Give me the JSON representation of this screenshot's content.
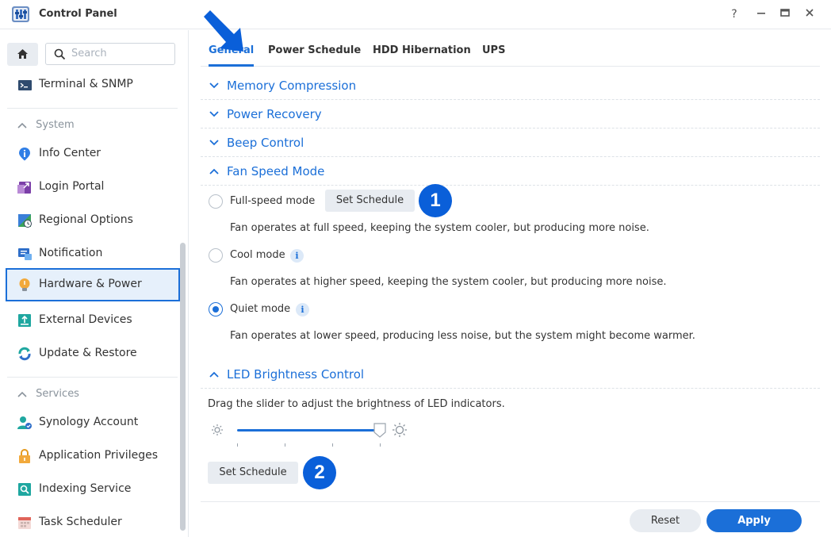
{
  "window": {
    "title": "Control Panel",
    "help_glyph": "?",
    "minimize_glyph": "—",
    "maximize_glyph": "▭",
    "close_glyph": "✕"
  },
  "sidebar": {
    "search_placeholder": "Search",
    "top_items": [
      {
        "label": "Terminal & SNMP",
        "icon": "terminal-icon"
      }
    ],
    "groups": [
      {
        "header": "System",
        "items": [
          {
            "label": "Info Center",
            "icon": "info-center-icon"
          },
          {
            "label": "Login Portal",
            "icon": "login-portal-icon"
          },
          {
            "label": "Regional Options",
            "icon": "regional-options-icon"
          },
          {
            "label": "Notification",
            "icon": "notification-icon"
          },
          {
            "label": "Hardware & Power",
            "icon": "hardware-power-icon",
            "active": true
          },
          {
            "label": "External Devices",
            "icon": "external-devices-icon"
          },
          {
            "label": "Update & Restore",
            "icon": "update-restore-icon"
          }
        ]
      },
      {
        "header": "Services",
        "items": [
          {
            "label": "Synology Account",
            "icon": "synology-account-icon"
          },
          {
            "label": "Application Privileges",
            "icon": "application-privileges-icon"
          },
          {
            "label": "Indexing Service",
            "icon": "indexing-service-icon"
          },
          {
            "label": "Task Scheduler",
            "icon": "task-scheduler-icon"
          }
        ]
      }
    ]
  },
  "tabs": [
    {
      "label": "General",
      "active": true
    },
    {
      "label": "Power Schedule"
    },
    {
      "label": "HDD Hibernation"
    },
    {
      "label": "UPS"
    }
  ],
  "sections": {
    "memory_compression": "Memory Compression",
    "power_recovery": "Power Recovery",
    "beep_control": "Beep Control",
    "fan_speed_mode": "Fan Speed Mode",
    "led_brightness": "LED Brightness Control"
  },
  "fan_modes": [
    {
      "label": "Full-speed mode",
      "description": "Fan operates at full speed, keeping the system cooler, but producing more noise.",
      "checked": false
    },
    {
      "label": "Cool mode",
      "description": "Fan operates at higher speed, keeping the system cooler, but producing more noise.",
      "checked": false
    },
    {
      "label": "Quiet mode",
      "description": "Fan operates at lower speed, producing less noise, but the system might become warmer.",
      "checked": true
    }
  ],
  "info_glyph": "i",
  "buttons": {
    "set_schedule_fan": "Set Schedule",
    "set_schedule_led": "Set Schedule",
    "reset": "Reset",
    "apply": "Apply"
  },
  "annotations": {
    "badge_1": "1",
    "badge_2": "2"
  },
  "led": {
    "instruction": "Drag the slider to adjust the brightness of LED indicators.",
    "level": 1.0
  },
  "colors": {
    "accent": "#1b6fd8",
    "badge": "#0a5fd9"
  }
}
